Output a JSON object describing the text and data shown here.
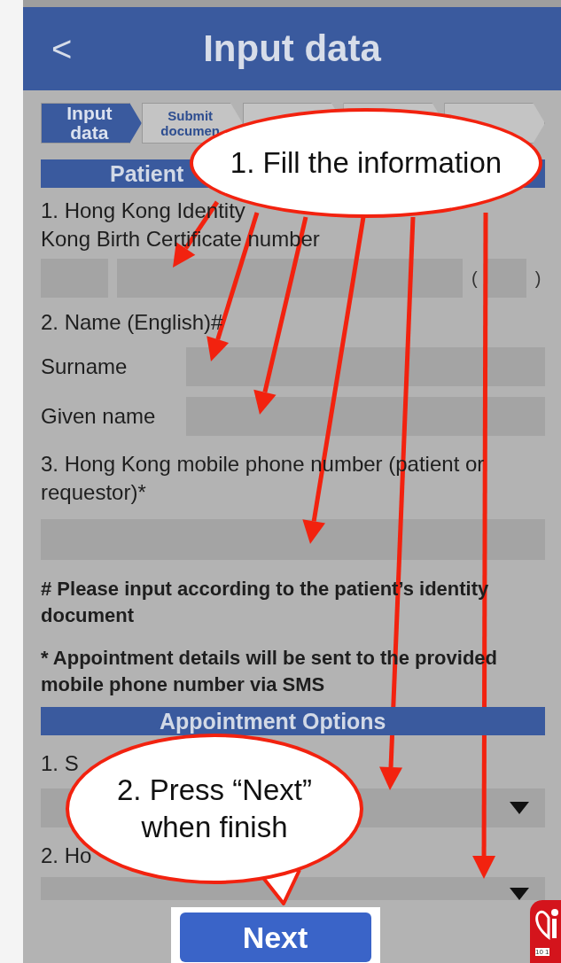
{
  "nav": {
    "back": "<",
    "title": "Input data"
  },
  "steps": [
    {
      "label": "Input data",
      "selected": true
    },
    {
      "label": "Submit documen",
      "selected": false
    },
    {
      "selected": false
    },
    {
      "selected": false
    },
    {
      "selected": false
    }
  ],
  "patient_section": {
    "header": "Patient",
    "question_1": [
      "1. Hong Kong Identity",
      "Kong Birth Certificate number"
    ],
    "id_parens": [
      "(",
      ")"
    ],
    "question_2": "2. Name (English)#",
    "surname": "Surname",
    "given_name": "Given name",
    "question_3": "3. Hong Kong mobile phone number (patient or requestor)*"
  },
  "notes": [
    "# Please input according to the patient’s identity document",
    "* Appointment details will be sent to the provided mobile phone number via SMS"
  ],
  "appointment_section": {
    "header": "Appointment Options",
    "option_1": "1. S",
    "option_2": "2. Ho"
  },
  "next_button": "Next",
  "callouts": [
    "1. Fill the information",
    "2. Press “Next” when finish"
  ],
  "logo_text": "10 1"
}
